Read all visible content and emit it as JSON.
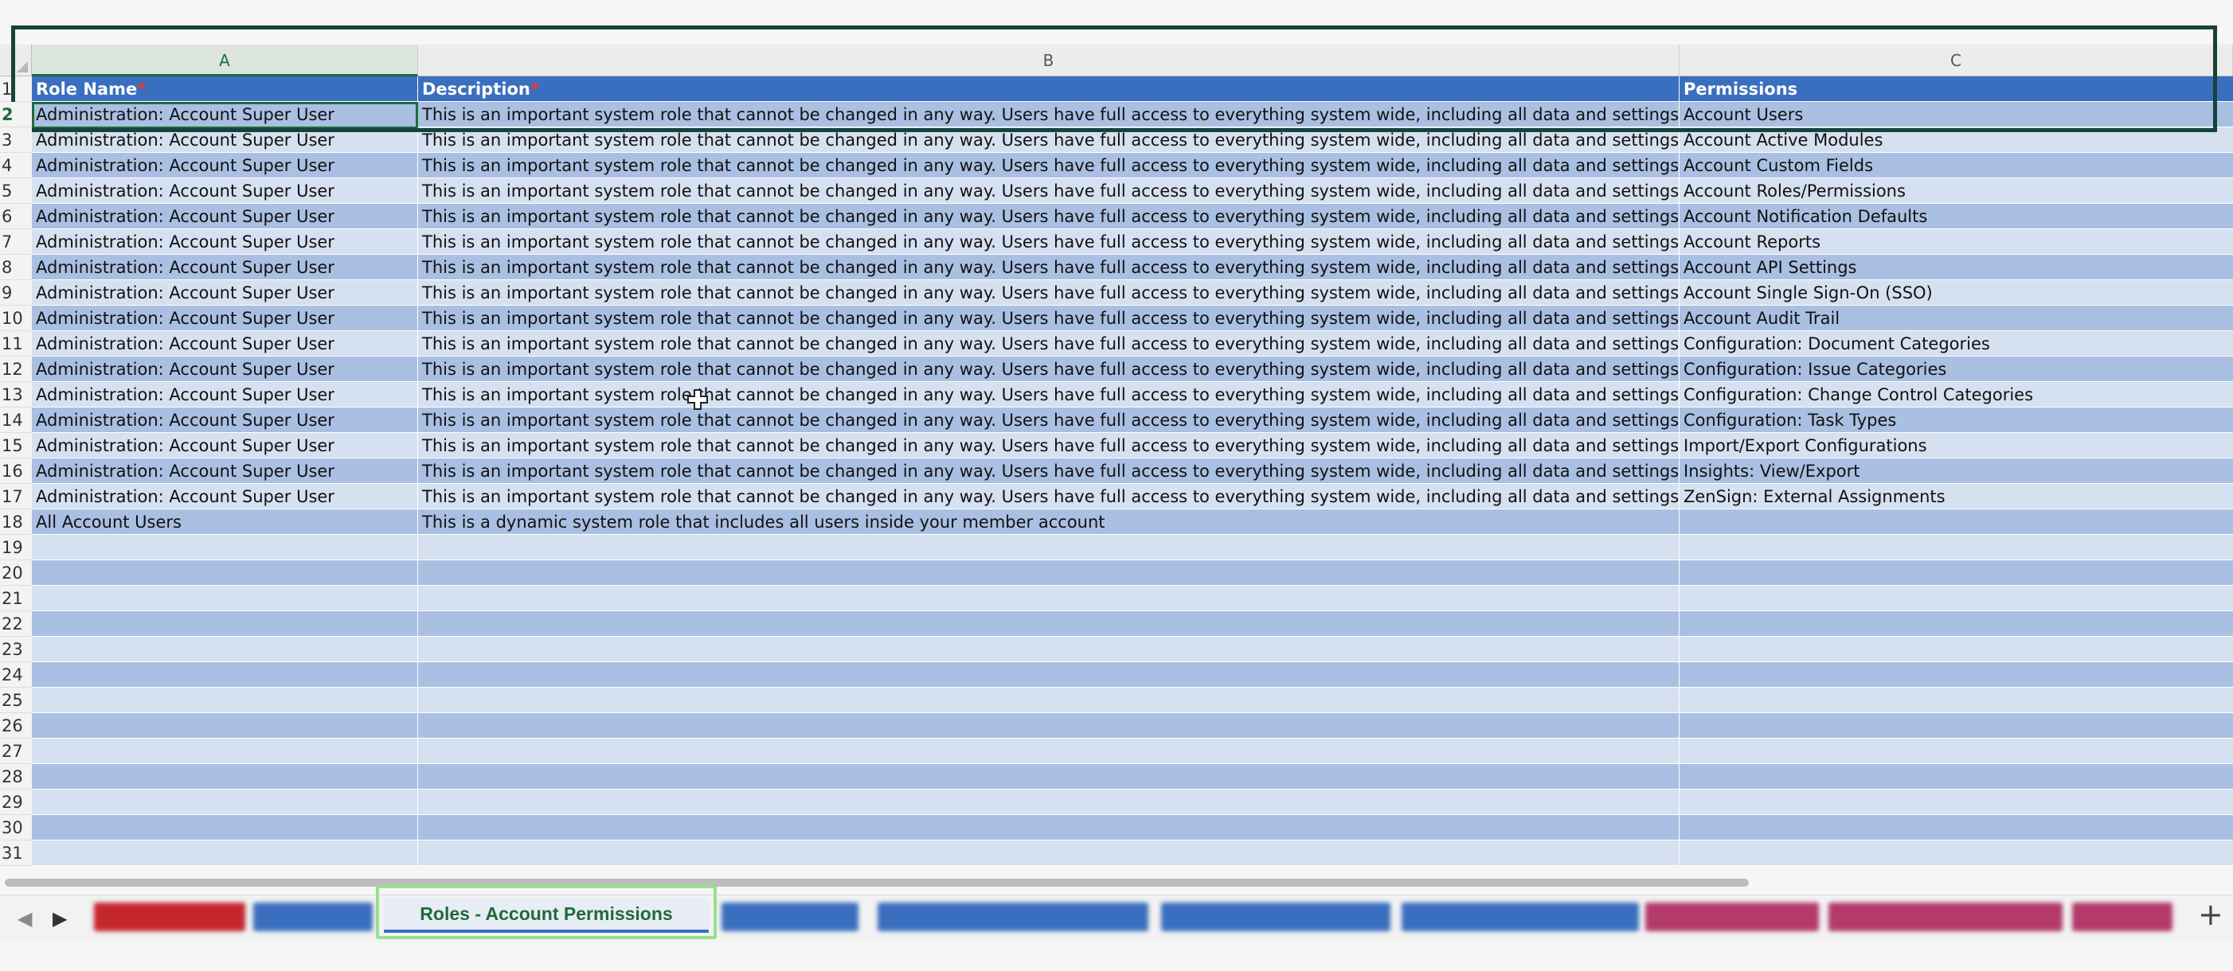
{
  "columns": [
    "A",
    "B",
    "C"
  ],
  "header_row": {
    "number": "1",
    "role_name": "Role Name",
    "description": "Description",
    "permissions": "Permissions",
    "required_mark": "*"
  },
  "rows": [
    {
      "num": "2",
      "a": "Administration: Account Super User",
      "b": "This is an important system role that cannot be changed in any way. Users have full access to everything system wide, including all data and settings.",
      "c": "Account Users"
    },
    {
      "num": "3",
      "a": "Administration: Account Super User",
      "b": "This is an important system role that cannot be changed in any way. Users have full access to everything system wide, including all data and settings.",
      "c": "Account Active Modules"
    },
    {
      "num": "4",
      "a": "Administration: Account Super User",
      "b": "This is an important system role that cannot be changed in any way. Users have full access to everything system wide, including all data and settings.",
      "c": "Account Custom Fields"
    },
    {
      "num": "5",
      "a": "Administration: Account Super User",
      "b": "This is an important system role that cannot be changed in any way. Users have full access to everything system wide, including all data and settings.",
      "c": "Account Roles/Permissions"
    },
    {
      "num": "6",
      "a": "Administration: Account Super User",
      "b": "This is an important system role that cannot be changed in any way. Users have full access to everything system wide, including all data and settings.",
      "c": "Account Notification Defaults"
    },
    {
      "num": "7",
      "a": "Administration: Account Super User",
      "b": "This is an important system role that cannot be changed in any way. Users have full access to everything system wide, including all data and settings.",
      "c": "Account Reports"
    },
    {
      "num": "8",
      "a": "Administration: Account Super User",
      "b": "This is an important system role that cannot be changed in any way. Users have full access to everything system wide, including all data and settings.",
      "c": "Account API Settings"
    },
    {
      "num": "9",
      "a": "Administration: Account Super User",
      "b": "This is an important system role that cannot be changed in any way. Users have full access to everything system wide, including all data and settings.",
      "c": "Account Single Sign-On (SSO)"
    },
    {
      "num": "10",
      "a": "Administration: Account Super User",
      "b": "This is an important system role that cannot be changed in any way. Users have full access to everything system wide, including all data and settings.",
      "c": "Account Audit Trail"
    },
    {
      "num": "11",
      "a": "Administration: Account Super User",
      "b": "This is an important system role that cannot be changed in any way. Users have full access to everything system wide, including all data and settings.",
      "c": "Configuration: Document Categories"
    },
    {
      "num": "12",
      "a": "Administration: Account Super User",
      "b": "This is an important system role that cannot be changed in any way. Users have full access to everything system wide, including all data and settings.",
      "c": "Configuration: Issue Categories"
    },
    {
      "num": "13",
      "a": "Administration: Account Super User",
      "b": "This is an important system role that cannot be changed in any way. Users have full access to everything system wide, including all data and settings.",
      "c": "Configuration: Change Control Categories"
    },
    {
      "num": "14",
      "a": "Administration: Account Super User",
      "b": "This is an important system role that cannot be changed in any way. Users have full access to everything system wide, including all data and settings.",
      "c": "Configuration: Task Types"
    },
    {
      "num": "15",
      "a": "Administration: Account Super User",
      "b": "This is an important system role that cannot be changed in any way. Users have full access to everything system wide, including all data and settings.",
      "c": "Import/Export Configurations"
    },
    {
      "num": "16",
      "a": "Administration: Account Super User",
      "b": "This is an important system role that cannot be changed in any way. Users have full access to everything system wide, including all data and settings.",
      "c": "Insights: View/Export"
    },
    {
      "num": "17",
      "a": "Administration: Account Super User",
      "b": "This is an important system role that cannot be changed in any way. Users have full access to everything system wide, including all data and settings.",
      "c": "ZenSign: External Assignments"
    },
    {
      "num": "18",
      "a": "All Account Users",
      "b": "This is a dynamic system role that includes all users inside your member account",
      "c": ""
    },
    {
      "num": "19",
      "a": "",
      "b": "",
      "c": ""
    },
    {
      "num": "20",
      "a": "",
      "b": "",
      "c": ""
    },
    {
      "num": "21",
      "a": "",
      "b": "",
      "c": ""
    },
    {
      "num": "22",
      "a": "",
      "b": "",
      "c": ""
    },
    {
      "num": "23",
      "a": "",
      "b": "",
      "c": ""
    },
    {
      "num": "24",
      "a": "",
      "b": "",
      "c": ""
    },
    {
      "num": "25",
      "a": "",
      "b": "",
      "c": ""
    },
    {
      "num": "26",
      "a": "",
      "b": "",
      "c": ""
    },
    {
      "num": "27",
      "a": "",
      "b": "",
      "c": ""
    },
    {
      "num": "28",
      "a": "",
      "b": "",
      "c": ""
    },
    {
      "num": "29",
      "a": "",
      "b": "",
      "c": ""
    },
    {
      "num": "30",
      "a": "",
      "b": "",
      "c": ""
    },
    {
      "num": "31",
      "a": "",
      "b": "",
      "c": ""
    }
  ],
  "active_tab": {
    "label": "Roles - Account Permissions"
  },
  "tabs": [
    {
      "color": "#c4262e"
    },
    {
      "color": "#3a6fbf"
    },
    {
      "color": "#3a6fbf"
    },
    {
      "color": "#3a6fbf"
    },
    {
      "color": "#3a6fbf"
    },
    {
      "color": "#3a6fbf"
    },
    {
      "color": "#b33a6a"
    },
    {
      "color": "#b33a6a"
    },
    {
      "color": "#b33a6a"
    }
  ],
  "nav": {
    "prev": "◀",
    "next": "▶",
    "add": "+"
  },
  "colors": {
    "header_blue": "#3a6fbf",
    "row_dark": "#a9c0e2",
    "row_light": "#d5e0f0",
    "selection_green": "#1f6b3a",
    "tab_highlight": "#97e08c"
  }
}
